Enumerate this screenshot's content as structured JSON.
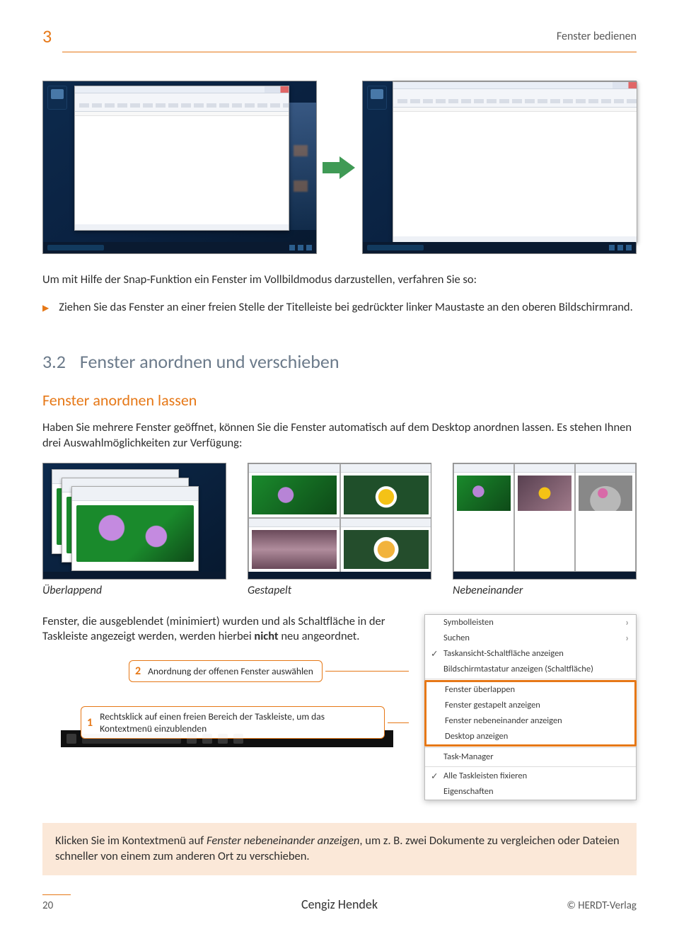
{
  "header": {
    "chapter": "3",
    "title": "Fenster bedienen"
  },
  "intro": "Um mit Hilfe der Snap-Funktion ein Fenster im Vollbildmodus darzustellen, verfahren Sie so:",
  "bullet": "Ziehen Sie das Fenster an einer freien Stelle der Titelleiste bei gedrückter linker Maustaste an den oberen Bildschirmrand.",
  "section": {
    "num": "3.2",
    "title": "Fenster anordnen und verschieben"
  },
  "sub": "Fenster anordnen lassen",
  "para2": "Haben Sie mehrere Fenster geöffnet, können Sie die Fenster automatisch auf dem Desktop anordnen lassen. Es stehen Ihnen drei Auswahlmöglichkeiten zur Verfügung:",
  "captions": {
    "a": "Überlappend",
    "b": "Gestapelt",
    "c": "Nebeneinander"
  },
  "para3a": "Fenster, die ausgeblendet (minimiert) wurden und als Schaltfläche in der Taskleiste angezeigt werden, werden hierbei ",
  "para3b": "nicht",
  "para3c": " neu angeordnet.",
  "menu": {
    "symbolleisten": "Symbolleisten",
    "suchen": "Suchen",
    "taskansicht": "Taskansicht-Schaltfläche anzeigen",
    "bildtast": "Bildschirmtastatur anzeigen (Schaltfläche)",
    "ueberlappen": "Fenster überlappen",
    "gestapelt": "Fenster gestapelt anzeigen",
    "neben": "Fenster nebeneinander anzeigen",
    "desktop": "Desktop anzeigen",
    "taskmgr": "Task-Manager",
    "fix": "Alle Taskleisten fixieren",
    "eig": "Eigenschaften"
  },
  "steps": {
    "s2": "Anordnung der offenen Fenster auswählen",
    "s1": "Rechtsklick auf einen freien Bereich der Taskleiste, um das Kontextmenü einzublenden"
  },
  "tip_a": "Klicken Sie im Kontextmenü auf ",
  "tip_i": "Fenster nebeneinander anzeigen",
  "tip_b": ", um z. B. zwei Dokumente zu vergleichen oder Dateien schneller von einem zum anderen Ort zu verschieben.",
  "footer": {
    "page": "20",
    "author": "Cengiz Hendek",
    "publisher": "© HERDT-Verlag"
  }
}
